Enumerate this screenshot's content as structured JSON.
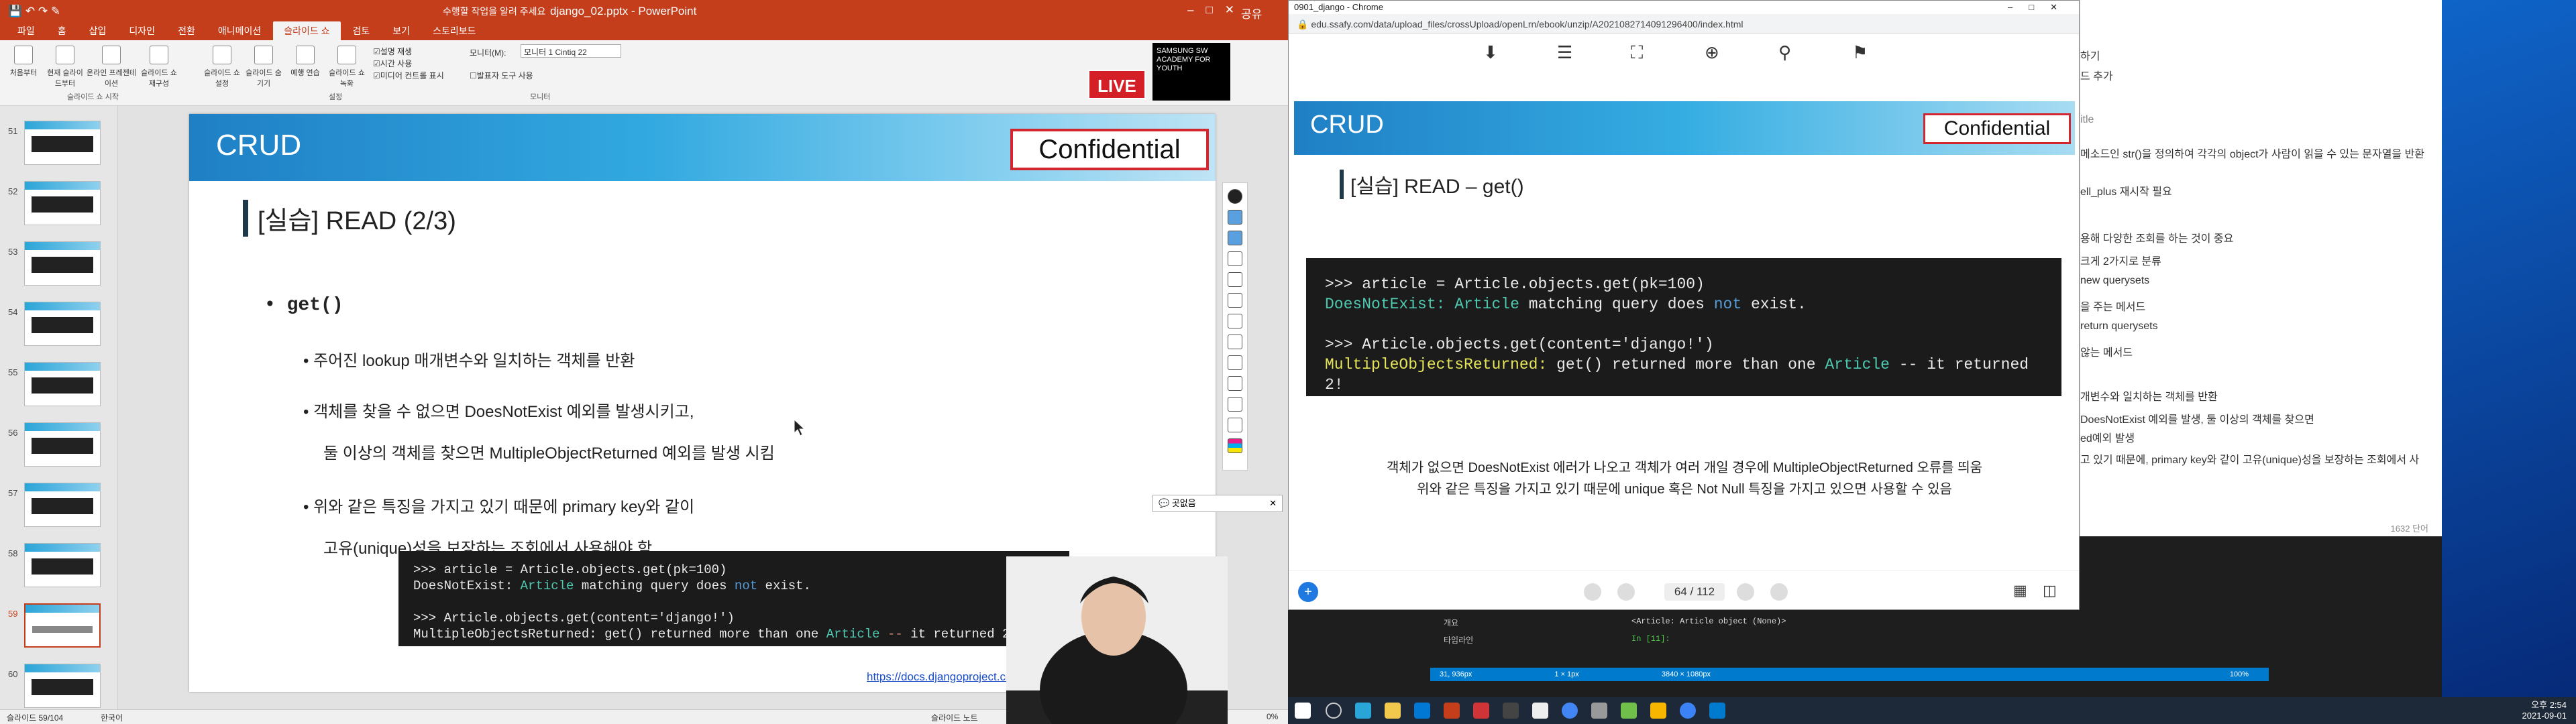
{
  "powerpoint": {
    "window_title": "django_02.pptx - PowerPoint",
    "tell_me": "수행할 작업을 알려 주세요",
    "user": "공유",
    "tabs": [
      "파일",
      "홈",
      "삽입",
      "디자인",
      "전환",
      "애니메이션",
      "슬라이드 쇼",
      "검토",
      "보기",
      "스토리보드"
    ],
    "active_tab_index": 6,
    "ribbon": {
      "buttons": [
        "처음부터",
        "현재 슬라이드부터",
        "온라인 프레젠테이션",
        "슬라이드 쇼 재구성",
        "슬라이드 쇼 설정",
        "슬라이드 숨기기",
        "예행 연습",
        "슬라이드 쇼 녹화"
      ],
      "checks": [
        {
          "label": "설명 재생",
          "on": true
        },
        {
          "label": "시간 사용",
          "on": true
        },
        {
          "label": "미디어 컨트롤 표시",
          "on": true
        },
        {
          "label": "발표자 도구 사용",
          "on": false
        }
      ],
      "monitor_label": "모니터(M):",
      "monitor_value": "모니터 1 Cintiq 22",
      "groups": [
        "슬라이드 쇼 시작",
        "설정",
        "모니터"
      ]
    },
    "thumbnails": [
      "51",
      "52",
      "53",
      "54",
      "55",
      "56",
      "57",
      "58",
      "59",
      "60"
    ],
    "selected_thumb_index": 8,
    "status_left": "슬라이드 59/104",
    "status_lang": "한국어",
    "status_notes": "슬라이드 노트",
    "status_zoom": "0%",
    "slide": {
      "header": "CRUD",
      "confidential": "Confidential",
      "title": "[실습] READ (2/3)",
      "bullet_main": "get()",
      "bullets": [
        "주어진 lookup 매개변수와 일치하는 객체를 반환",
        "객체를 찾을 수 없으면 DoesNotExist 예외를 발생시키고,",
        "둘 이상의 객체를 찾으면 MultipleObjectReturned 예외를 발생 시킴",
        "위와 같은 특징을 가지고 있기 때문에 primary key와 같이",
        "고유(unique)성을 보장하는 조회에서 사용해야 함"
      ],
      "link": "https://docs.djangoproject.com/",
      "link_tail": "get"
    },
    "live_badge": "LIVE",
    "samsung_logo": "SAMSUNG SW ACADEMY FOR YOUTH",
    "chat_label": "곳없음"
  },
  "chrome": {
    "window_title": "0901_django - Chrome",
    "url": "edu.ssafy.com/data/upload_files/crossUpload/openLrn/ebook/unzip/A2021082714091296400/index.html",
    "page_indicator": "64 / 112",
    "slide": {
      "header": "CRUD",
      "confidential": "Confidential",
      "title": "[실습] READ – get()",
      "notes": [
        "객체가 없으면 DoesNotExist 에러가 나오고 객체가 여러 개일 경우에 MultipleObjectReturned 오류를 띄움",
        "위와 같은 특징을 가지고 있기 때문에 unique 혹은 Not Null 특징을 가지고 있으면 사용할 수 있음"
      ]
    }
  },
  "code": {
    "line1": ">>> article = Article.objects.get(pk=100)",
    "line2_a": "DoesNotExist:",
    "line2_b": "Article",
    "line2_c": "matching query does",
    "line2_d": "not",
    "line2_e": "exist.",
    "line3": ">>> Article.objects.get(content='django!')",
    "line4_a": "MultipleObjectsReturned:",
    "line4_b": "get() returned more than one",
    "line4_c": "Article",
    "line4_d": "--",
    "line4_e": "it returned 2!"
  },
  "vscode_notes": {
    "lines": [
      "하기",
      "드 추가",
      "itle",
      "메소드인 str()을 정의하여 각각의 object가 사람이 읽을 수 있는 문자열을 반환",
      "ell_plus 재시작 필요",
      "용해 다양한 조회를 하는 것이 중요",
      "크게 2가지로 분류",
      "new querysets",
      "을 주는 메서드",
      "return querysets",
      "않는 메서드",
      "개변수와 일치하는 객체를 반환",
      "DoesNotExist 예외를 발생, 둘 이상의 객체를 찾으면",
      "ed예외 발생",
      "고 있기 때문에, primary key와 같이 고유(unique)성을 보장하는 조회에서 사"
    ],
    "char_count": "1632 단어"
  },
  "vscode_bottom": {
    "terminal_line": "<Article: Article object (None)>",
    "terminal_prompt": "In [11]:",
    "explorer_items": [
      "개요",
      "타임라인"
    ],
    "status_right": "3840 × 1080px",
    "status_pos": "31, 936px",
    "status_size": "1 × 1px",
    "zoom": "100%"
  },
  "clock": {
    "time": "오후 2:54",
    "date": "2021-09-01"
  }
}
